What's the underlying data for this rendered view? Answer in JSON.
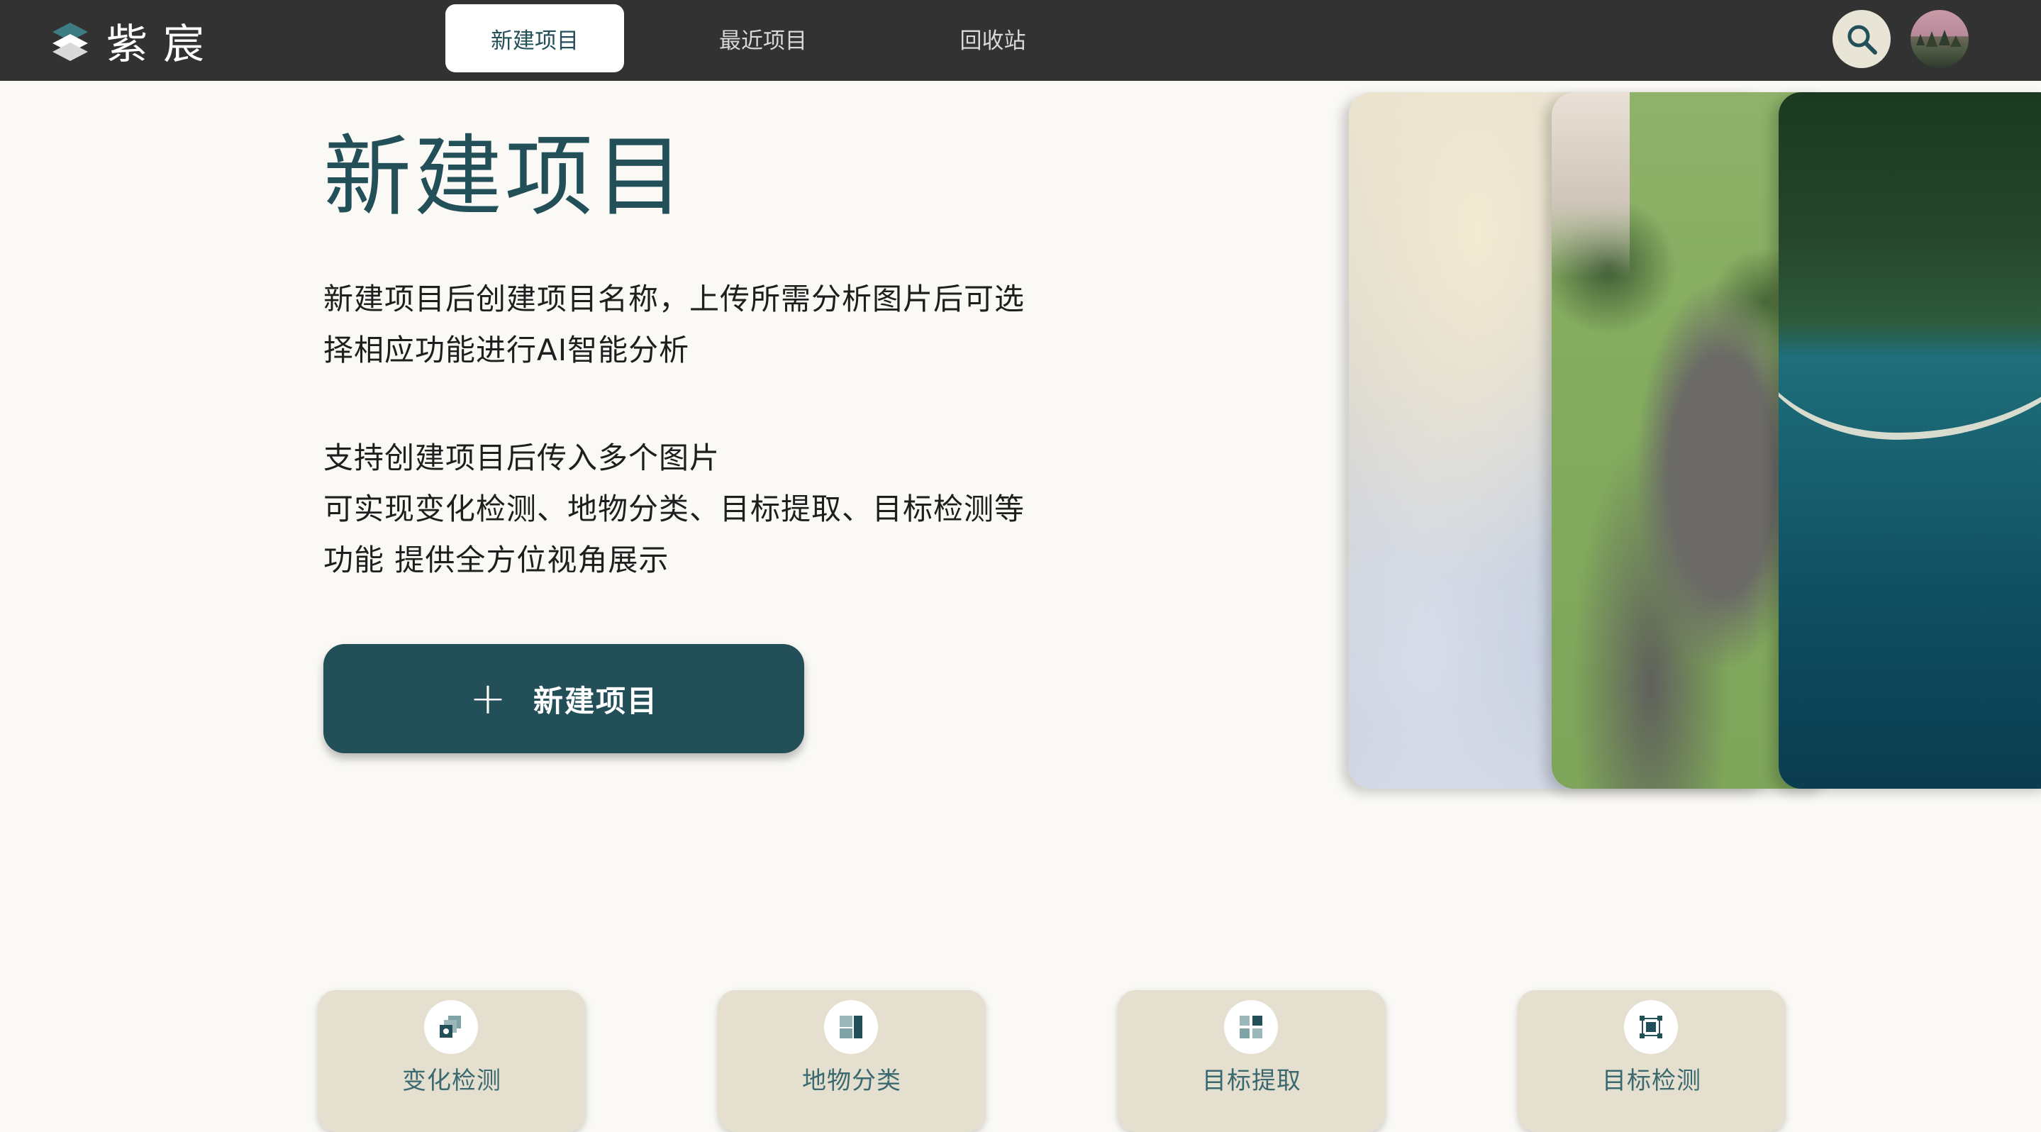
{
  "header": {
    "brand_name": "紫宸",
    "tabs": [
      {
        "label": "新建项目",
        "active": true
      },
      {
        "label": "最近项目",
        "active": false
      },
      {
        "label": "回收站",
        "active": false
      }
    ],
    "search_icon": "search-icon",
    "avatar_icon": "user-avatar"
  },
  "hero": {
    "title": "新建项目",
    "paragraph1_line1": "新建项目后创建项目名称，上传所需分析图片后可选",
    "paragraph1_line2": "择相应功能进行AI智能分析",
    "paragraph2_line1": "支持创建项目后传入多个图片",
    "paragraph2_line2": "可实现变化检测、地物分类、目标提取、目标检测等",
    "paragraph2_line3": "功能 提供全方位视角展示",
    "create_button_icon": "+",
    "create_button_label": "新建项目"
  },
  "features": [
    {
      "label": "变化检测",
      "icon": "change-detection-icon"
    },
    {
      "label": "地物分类",
      "icon": "land-classification-icon"
    },
    {
      "label": "目标提取",
      "icon": "target-extraction-icon"
    },
    {
      "label": "目标检测",
      "icon": "target-detection-icon"
    }
  ],
  "colors": {
    "topbar": "#323232",
    "accent": "#224F58",
    "background": "#FAF9F5",
    "card": "#E4DFCF"
  }
}
